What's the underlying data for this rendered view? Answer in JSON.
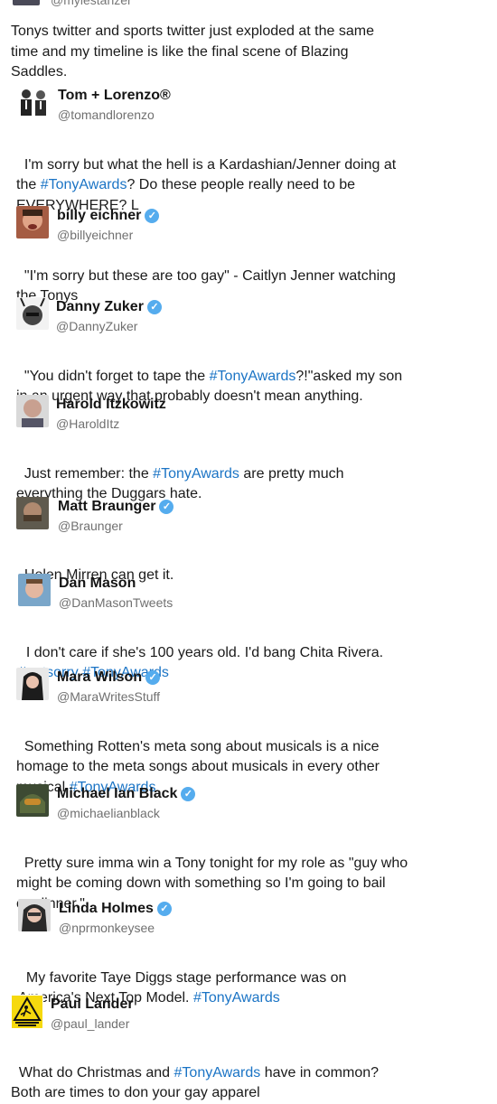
{
  "top": {
    "handle": "@mylestanzer",
    "text": "Tonys twitter and sports twitter just exploded at the same time and my timeline is like the final scene of Blazing Saddles."
  },
  "tweets": [
    {
      "name": "Tom + Lorenzo®",
      "handle": "@tomandlorenzo",
      "verified": false,
      "segments": [
        "I'm sorry but what the hell is a Kardashian/Jenner doing at\nthe ",
        "#TonyAwards",
        "? Do these people really need to be\nEVERYWHERE? L"
      ]
    },
    {
      "name": "billy eichner",
      "handle": "@billyeichner",
      "verified": true,
      "segments": [
        "\"I'm sorry but these are too gay\" - Caitlyn Jenner watching\nthe Tonys"
      ]
    },
    {
      "name": "Danny Zuker",
      "handle": "@DannyZuker",
      "verified": true,
      "segments": [
        "\"You didn't forget to tape the ",
        "#TonyAwards",
        "?!\"asked my son\nin an urgent way that probably doesn't mean anything."
      ]
    },
    {
      "name": "Harold Itzkowitz",
      "handle": "@HaroldItz",
      "verified": false,
      "segments": [
        "Just remember: the ",
        "#TonyAwards",
        " are pretty much\neverything the Duggars hate."
      ]
    },
    {
      "name": "Matt Braunger",
      "handle": "@Braunger",
      "verified": true,
      "segments": [
        "Helen Mirren can get it."
      ]
    },
    {
      "name": "Dan Mason",
      "handle": "@DanMasonTweets",
      "verified": false,
      "segments": [
        "I don't care if she's 100 years old. I'd bang Chita Rivera.\n",
        "#notsorry",
        " ",
        "#TonyAwards"
      ]
    },
    {
      "name": "Mara Wilson",
      "handle": "@MaraWritesStuff",
      "verified": true,
      "segments": [
        "Something Rotten's meta song about musicals is a nice\nhomage to the meta songs about musicals in every other\nmusical ",
        "#TonyAwards"
      ]
    },
    {
      "name": "Michael Ian Black",
      "handle": "@michaelianblack",
      "verified": true,
      "segments": [
        "Pretty sure imma win a Tony tonight for my role as \"guy who\nmight be coming down with something so I'm going to bail\non dinner.\""
      ]
    },
    {
      "name": "Linda Holmes",
      "handle": "@nprmonkeysee",
      "verified": true,
      "segments": [
        "My favorite Taye Diggs stage performance was on\nAmerica's Next Top Model. ",
        "#TonyAwards"
      ]
    },
    {
      "name": "Paul Lander",
      "handle": "@paul_lander",
      "verified": false,
      "segments": [
        "What do Christmas and ",
        "#TonyAwards",
        " have in common?\nBoth are times to don your gay apparel"
      ]
    }
  ],
  "icons": {
    "verified": "verified-badge-icon",
    "slippery_sign": "slippery-when-wet-sign-icon"
  },
  "colors": {
    "hashtag": "#1b74c5",
    "verified": "#55acee",
    "handle": "#707070"
  }
}
